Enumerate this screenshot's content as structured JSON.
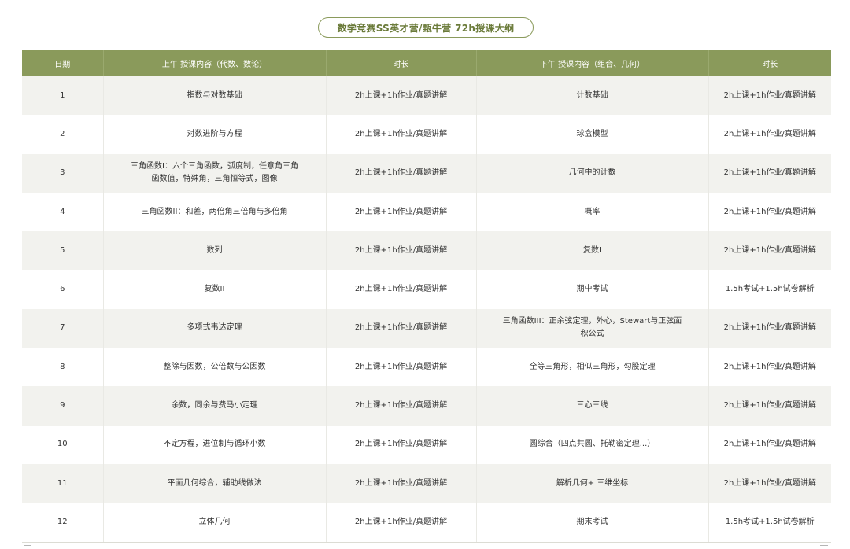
{
  "title": "数学竞赛SS英才营/甄牛营 72h授课大纲",
  "columns": {
    "day": "日期",
    "am": "上午 授课内容（代数、数论）",
    "am_duration": "时长",
    "pm": "下午 授课内容（组合、几何）",
    "pm_duration": "时长"
  },
  "rows": [
    {
      "day": "1",
      "am": "指数与对数基础",
      "am_duration": "2h上课+1h作业/真题讲解",
      "pm": "计数基础",
      "pm_duration": "2h上课+1h作业/真题讲解"
    },
    {
      "day": "2",
      "am": "对数进阶与方程",
      "am_duration": "2h上课+1h作业/真题讲解",
      "pm": "球盒模型",
      "pm_duration": "2h上课+1h作业/真题讲解"
    },
    {
      "day": "3",
      "am": "三角函数I：六个三角函数，弧度制，任意角三角函数值，特殊角，三角恒等式，图像",
      "am_duration": "2h上课+1h作业/真题讲解",
      "pm": "几何中的计数",
      "pm_duration": "2h上课+1h作业/真题讲解"
    },
    {
      "day": "4",
      "am": "三角函数II：和差，两倍角三倍角与多倍角",
      "am_duration": "2h上课+1h作业/真题讲解",
      "pm": "概率",
      "pm_duration": "2h上课+1h作业/真题讲解"
    },
    {
      "day": "5",
      "am": "数列",
      "am_duration": "2h上课+1h作业/真题讲解",
      "pm": "复数I",
      "pm_duration": "2h上课+1h作业/真题讲解"
    },
    {
      "day": "6",
      "am": "复数II",
      "am_duration": "2h上课+1h作业/真题讲解",
      "pm": "期中考试",
      "pm_duration": "1.5h考试+1.5h试卷解析"
    },
    {
      "day": "7",
      "am": "多项式韦达定理",
      "am_duration": "2h上课+1h作业/真题讲解",
      "pm": "三角函数III：正余弦定理，外心，Stewart与正弦面积公式",
      "pm_duration": "2h上课+1h作业/真题讲解"
    },
    {
      "day": "8",
      "am": "整除与因数，公倍数与公因数",
      "am_duration": "2h上课+1h作业/真题讲解",
      "pm": "全等三角形，相似三角形，勾股定理",
      "pm_duration": "2h上课+1h作业/真题讲解"
    },
    {
      "day": "9",
      "am": "余数，同余与费马小定理",
      "am_duration": "2h上课+1h作业/真题讲解",
      "pm": "三心三线",
      "pm_duration": "2h上课+1h作业/真题讲解"
    },
    {
      "day": "10",
      "am": "不定方程，进位制与循环小数",
      "am_duration": "2h上课+1h作业/真题讲解",
      "pm": "圆综合（四点共圆、托勒密定理...）",
      "pm_duration": "2h上课+1h作业/真题讲解"
    },
    {
      "day": "11",
      "am": "平面几何综合，辅助线做法",
      "am_duration": "2h上课+1h作业/真题讲解",
      "pm": "解析几何+ 三维坐标",
      "pm_duration": "2h上课+1h作业/真题讲解"
    },
    {
      "day": "12",
      "am": "立体几何",
      "am_duration": "2h上课+1h作业/真题讲解",
      "pm": "期末考试",
      "pm_duration": "1.5h考试+1.5h试卷解析"
    }
  ],
  "colors": {
    "header_bg": "#8a9a5b",
    "title_text": "#6b7b3a",
    "row_alt_bg": "#f2f2ee"
  }
}
